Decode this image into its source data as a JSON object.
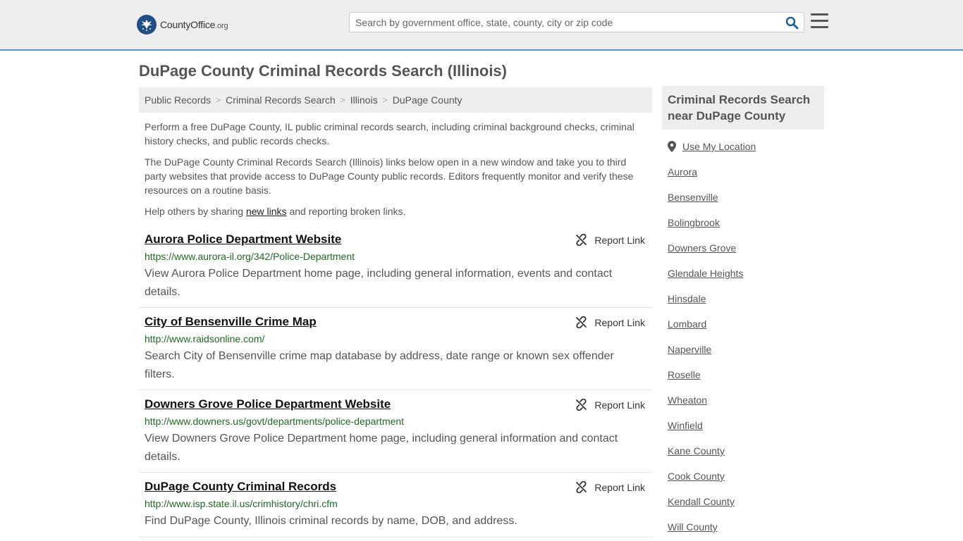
{
  "header": {
    "logo_text_main": "CountyOffice",
    "logo_text_tld": ".org",
    "search_placeholder": "Search by government office, state, county, city or zip code"
  },
  "page_title": "DuPage County Criminal Records Search (Illinois)",
  "breadcrumb": [
    "Public Records",
    "Criminal Records Search",
    "Illinois",
    "DuPage County"
  ],
  "intro": {
    "p1": "Perform a free DuPage County, IL public criminal records search, including criminal background checks, criminal history checks, and public records checks.",
    "p2": "The DuPage County Criminal Records Search (Illinois) links below open in a new window and take you to third party websites that provide access to DuPage County public records. Editors frequently monitor and verify these resources on a routine basis.",
    "p3_before": "Help others by sharing ",
    "p3_link": "new links",
    "p3_after": " and reporting broken links."
  },
  "report_label": "Report Link",
  "results": [
    {
      "title": "Aurora Police Department Website",
      "url": "https://www.aurora-il.org/342/Police-Department",
      "desc": "View Aurora Police Department home page, including general information, events and contact details."
    },
    {
      "title": "City of Bensenville Crime Map",
      "url": "http://www.raidsonline.com/",
      "desc": "Search City of Bensenville crime map database by address, date range or known sex offender filters."
    },
    {
      "title": "Downers Grove Police Department Website",
      "url": "http://www.downers.us/govt/departments/police-department",
      "desc": "View Downers Grove Police Department home page, including general information and contact details."
    },
    {
      "title": "DuPage County Criminal Records",
      "url": "http://www.isp.state.il.us/crimhistory/chri.cfm",
      "desc": "Find DuPage County, Illinois criminal records by name, DOB, and address."
    }
  ],
  "sidebar": {
    "heading": "Criminal Records Search near DuPage County",
    "use_location": "Use My Location",
    "links": [
      "Aurora",
      "Bensenville",
      "Bolingbrook",
      "Downers Grove",
      "Glendale Heights",
      "Hinsdale",
      "Lombard",
      "Naperville",
      "Roselle",
      "Wheaton",
      "Winfield",
      "Kane County",
      "Cook County",
      "Kendall County",
      "Will County"
    ]
  }
}
